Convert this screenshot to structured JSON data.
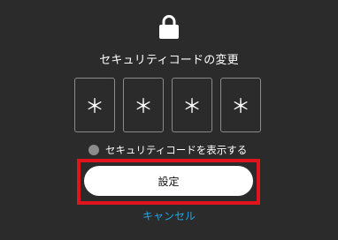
{
  "dialog": {
    "title": "セキュリティコードの変更",
    "code_digits": [
      "＊",
      "＊",
      "＊",
      "＊"
    ],
    "show_code_label": "セキュリティコードを表示する",
    "show_code_checked": false,
    "set_button_label": "設定",
    "cancel_label": "キャンセル"
  },
  "colors": {
    "background": "#2b2b2b",
    "highlight": "#e0141c",
    "link": "#1ea7e8",
    "button_bg": "#ffffff"
  },
  "icons": {
    "header": "lock-icon"
  }
}
